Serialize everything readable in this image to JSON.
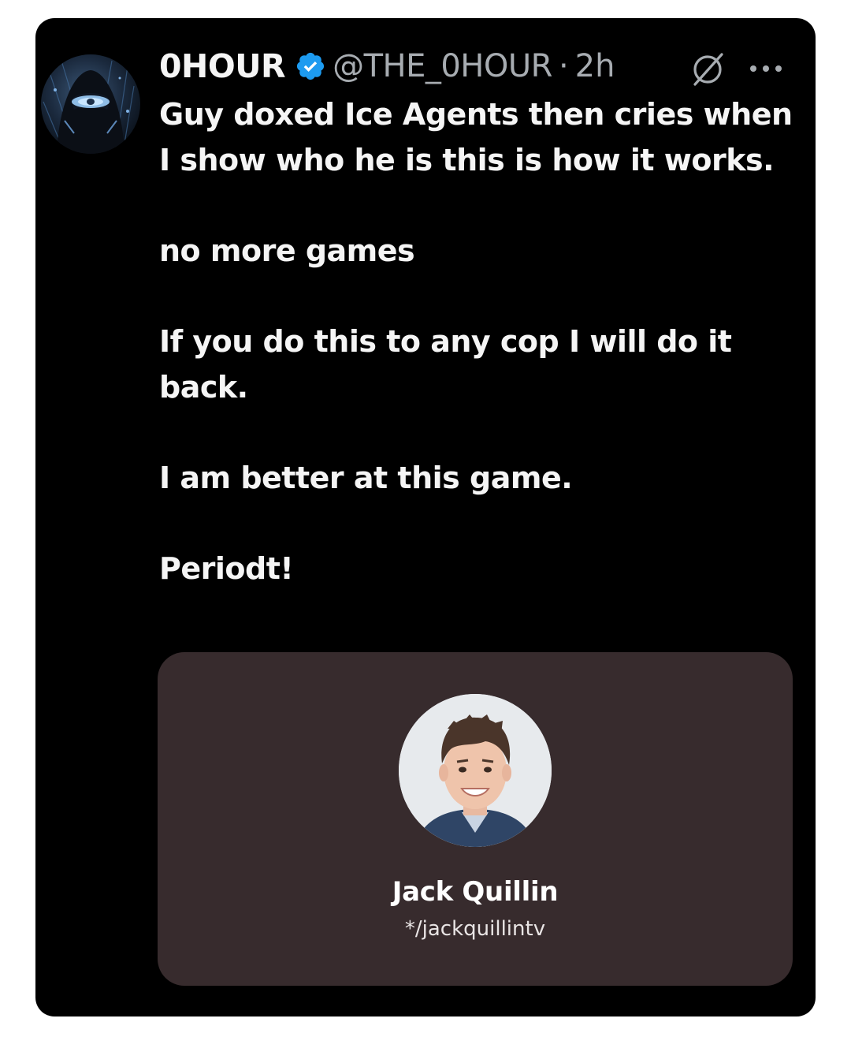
{
  "post": {
    "display_name": "0HOUR",
    "handle": "@THE_0HOUR",
    "separator": "·",
    "time": "2h",
    "paragraphs": [
      "Guy doxed Ice Agents then cries when I show who he is this is how it works.",
      "no more games",
      "If you do this to any cop I will do it back.",
      "I am better at this game.",
      "Periodt!"
    ]
  },
  "embed": {
    "name": "Jack Quillin",
    "link_icon": "linktree-asterisk",
    "link_text": "*/jackquillintv"
  },
  "icons": {
    "verified": "verified-badge-icon",
    "grok": "grok-icon",
    "more": "more-options-icon"
  },
  "colors": {
    "background": "#000000",
    "text": "#f5f5f5",
    "secondary_text": "#a7acb1",
    "verified_blue": "#1d9bf0",
    "embed_bg": "#372b2d"
  }
}
